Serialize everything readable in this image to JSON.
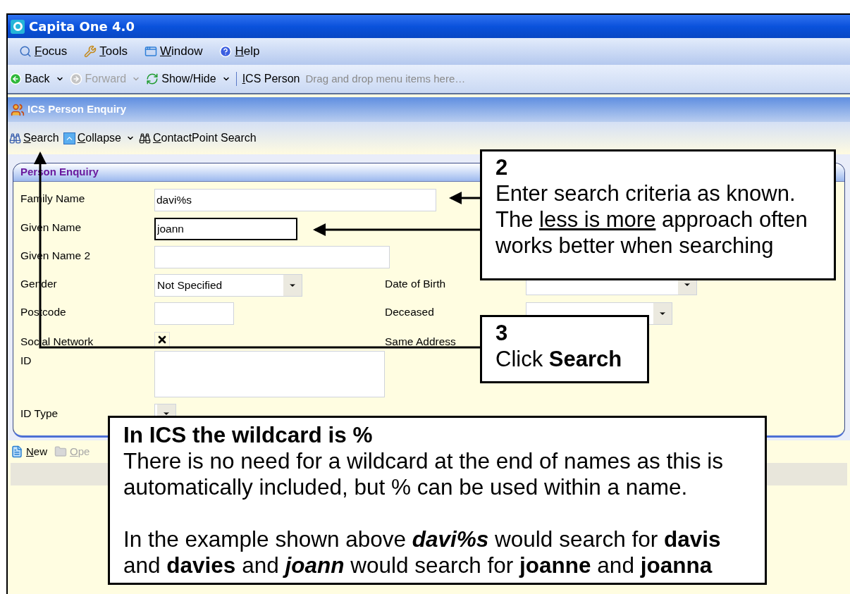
{
  "window": {
    "title": "Capita One 4.0"
  },
  "menu": [
    {
      "label": "Focus"
    },
    {
      "label": "Tools"
    },
    {
      "label": "Window"
    },
    {
      "label": "Help"
    }
  ],
  "toolbar": [
    {
      "kind": "button",
      "label": "Back",
      "dropdown": true,
      "disabled": false
    },
    {
      "kind": "button",
      "label": "Forward",
      "dropdown": true,
      "disabled": true
    },
    {
      "kind": "button",
      "label": "Show/Hide",
      "dropdown": true,
      "disabled": false
    },
    {
      "kind": "separator"
    },
    {
      "kind": "link",
      "label": "ICS Person"
    },
    {
      "kind": "hint",
      "label": "Drag and drop menu items here…"
    }
  ],
  "form_header": "ICS Person Enquiry",
  "actions": [
    {
      "label": "Search",
      "dropdown": false
    },
    {
      "label": "Collapse",
      "dropdown": true
    },
    {
      "label": "ContactPoint Search",
      "dropdown": false
    }
  ],
  "panel": {
    "title": "Person Enquiry",
    "rows": [
      {
        "left": {
          "label": "Family Name",
          "kind": "text",
          "value": "davi%s",
          "focused": false
        }
      },
      {
        "left": {
          "label": "Given Name",
          "kind": "text",
          "value": "joann",
          "focused": true
        }
      },
      {
        "left": {
          "label": "Given Name 2",
          "kind": "text",
          "focused": false
        }
      },
      {
        "left": {
          "label": "Gender",
          "kind": "dropdown",
          "value": "Not Specified"
        },
        "right": {
          "label": "Date of Birth",
          "kind": "dropdown"
        }
      },
      {
        "left": {
          "label": "Postcode",
          "kind": "text",
          "focused": false
        },
        "right": {
          "label": "Deceased",
          "kind": "dropdown"
        }
      },
      {
        "left": {
          "label": "Social Network",
          "kind": "checkbox",
          "checked": true
        },
        "right": {
          "label": "Same Address"
        }
      },
      {
        "left": {
          "label": "ID",
          "kind": "textarea"
        }
      },
      {
        "left": {
          "label": "ID Type",
          "kind": "dropdown"
        }
      }
    ]
  },
  "bottom_toolbar": [
    {
      "label": "New",
      "disabled": false
    },
    {
      "label": "Ope",
      "disabled": true
    }
  ],
  "callouts": [
    {
      "kind": "step",
      "number": "2",
      "body": [
        {
          "text": "Enter search criteria as known. The ",
          "kind": "plain"
        },
        {
          "text": "less is more",
          "kind": "underlined"
        },
        {
          "text": " approach often works better when searching",
          "kind": "plain"
        }
      ]
    },
    {
      "kind": "step",
      "number": "3",
      "body": [
        {
          "text": "Click ",
          "kind": "plain"
        },
        {
          "text": "Search",
          "kind": "bold"
        }
      ]
    },
    {
      "kind": "note",
      "title": "In ICS the wildcard is %",
      "paragraphs": [
        [
          {
            "text": "There is no need for a wildcard at the end of names as this is automatically included, but % can be used within a name.",
            "kind": "plain"
          }
        ],
        [
          {
            "text": "In the example shown above ",
            "kind": "plain"
          },
          {
            "text": "davi%s",
            "kind": "emphasis"
          },
          {
            "text": " would search for ",
            "kind": "plain"
          },
          {
            "text": "davis",
            "kind": "bold"
          },
          {
            "text": " and ",
            "kind": "plain"
          },
          {
            "text": "davies",
            "kind": "bold"
          },
          {
            "text": " and ",
            "kind": "plain"
          },
          {
            "text": "joann",
            "kind": "emphasis"
          },
          {
            "text": " would search for ",
            "kind": "plain"
          },
          {
            "text": "joanne",
            "kind": "bold"
          },
          {
            "text": " and ",
            "kind": "plain"
          },
          {
            "text": "joanna",
            "kind": "bold"
          }
        ]
      ]
    }
  ]
}
